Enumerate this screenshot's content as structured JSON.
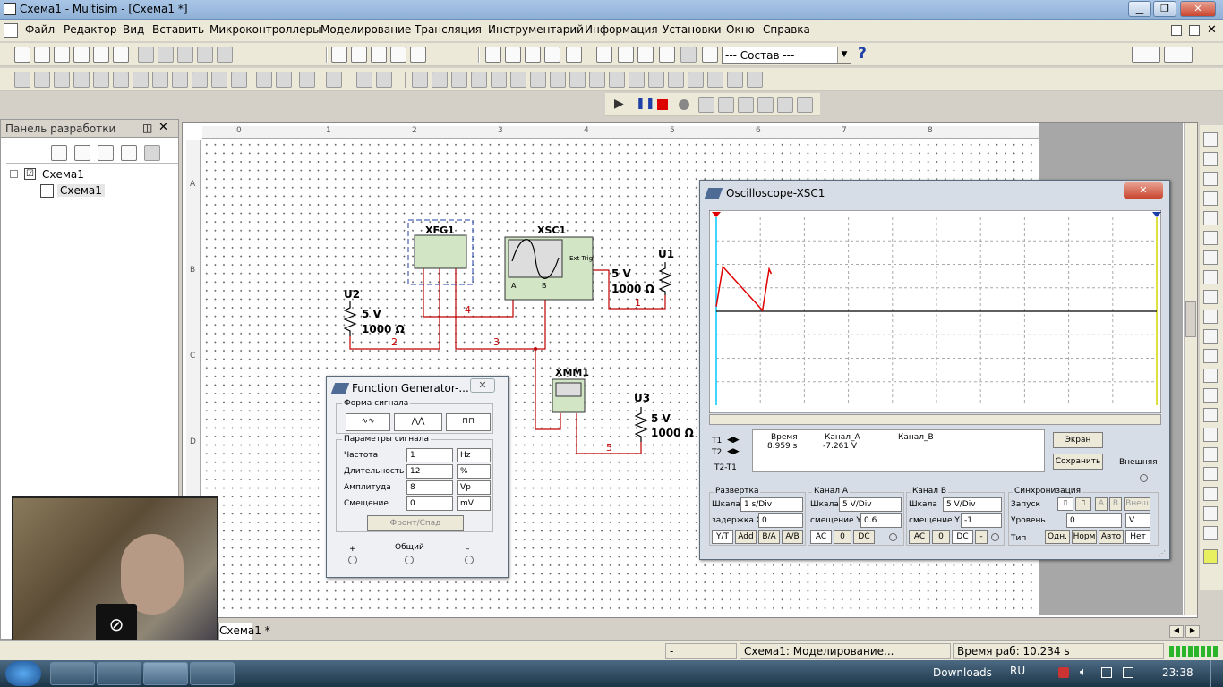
{
  "window": {
    "title": "Схема1 - Multisim - [Схема1 *]"
  },
  "menu": [
    "Файл",
    "Редактор",
    "Вид",
    "Вставить",
    "Микроконтроллеры",
    "Моделирование",
    "Трансляция",
    "Инструментарий",
    "Информация",
    "Установки",
    "Окно",
    "Справка"
  ],
  "toolbar": {
    "component_select": "--- Состав ---",
    "help_icon": "?"
  },
  "panel": {
    "title": "Панель разработки",
    "tree_root": "Схема1",
    "tree_child": "Схема1"
  },
  "canvas": {
    "ruler_top": [
      "0",
      "1",
      "2",
      "3",
      "4",
      "5",
      "6",
      "7",
      "8"
    ],
    "ruler_left": [
      "A",
      "B",
      "C",
      "D"
    ],
    "components": {
      "xfg1": "XFG1",
      "xsc1": "XSC1",
      "ext_trig": "Ext Trig",
      "chA": "A",
      "chB": "B",
      "xmm1": "XMM1",
      "u1": "U1",
      "u1_v": "5 V",
      "u1_r": "1000 Ω",
      "u2": "U2",
      "u2_v": "5 V",
      "u2_r": "1000 Ω",
      "u3": "U3",
      "u3_v": "5 V",
      "u3_r": "1000 Ω"
    },
    "nets": [
      "1",
      "2",
      "3",
      "4",
      "5"
    ],
    "tab": "Схема1 *"
  },
  "funcgen": {
    "title": "Function Generator-...",
    "waveform_group": "Форма сигнала",
    "params_group": "Параметры сигнала",
    "rows": [
      {
        "label": "Частота",
        "value": "1",
        "unit": "Hz"
      },
      {
        "label": "Длительность",
        "value": "12",
        "unit": "%"
      },
      {
        "label": "Амплитуда",
        "value": "8",
        "unit": "Vp"
      },
      {
        "label": "Смещение",
        "value": "0",
        "unit": "mV"
      }
    ],
    "edge_button": "Фронт/Спад",
    "term_plus": "+",
    "term_common": "Общий",
    "term_minus": "–"
  },
  "scope": {
    "title": "Oscilloscope-XSC1",
    "t1": "T1",
    "t2": "T2",
    "t2t1": "T2-T1",
    "col_time": "Время",
    "col_a": "Канал_A",
    "col_b": "Канал_B",
    "time_val": "8.959 s",
    "a_val": "-7.261 V",
    "screen_button": "Экран",
    "save_button": "Сохранить",
    "external_label": "Внешняя",
    "timebase": {
      "group": "Развертка",
      "scale_label": "Шкала",
      "scale": "1  s/Div",
      "delay_label": "задержка X",
      "delay": "0"
    },
    "chA": {
      "group": "Канал A",
      "scale_label": "Шкала",
      "scale": "5  V/Div",
      "offset_label": "смещение Y",
      "offset": "0.6"
    },
    "chB": {
      "group": "Канал B",
      "scale_label": "Шкала",
      "scale": "5  V/Div",
      "offset_label": "смещение Y",
      "offset": "-1"
    },
    "trigger": {
      "group": "Синхронизация",
      "start_label": "Запуск",
      "level_label": "Уровень",
      "level": "0",
      "level_unit": "V",
      "type_label": "Тип"
    },
    "trig_btns": [
      "A",
      "B",
      "Внеш"
    ],
    "bottom_btns": {
      "yt": "Y/T",
      "add": "Add",
      "ba": "B/A",
      "ab": "A/B",
      "ac1": "AC",
      "zero1": "0",
      "dc1": "DC",
      "ac2": "AC",
      "zero2": "0",
      "dc2": "DC",
      "dash": "-",
      "single": "Одн.",
      "norm": "Норм",
      "auto": "Авто",
      "none": "Нет"
    },
    "trace": [
      [
        0,
        -2
      ],
      [
        0.15,
        6.5
      ],
      [
        1.05,
        -2.8
      ],
      [
        1.2,
        6
      ],
      [
        1.25,
        5
      ]
    ],
    "trace_color": "#e00000"
  },
  "status": {
    "left": "-",
    "sim": "Схема1: Моделирование...",
    "runtime": "Время раб: 10.234 s"
  },
  "taskbar": {
    "downloads": "Downloads",
    "lang": "RU",
    "clock": "23:38"
  }
}
